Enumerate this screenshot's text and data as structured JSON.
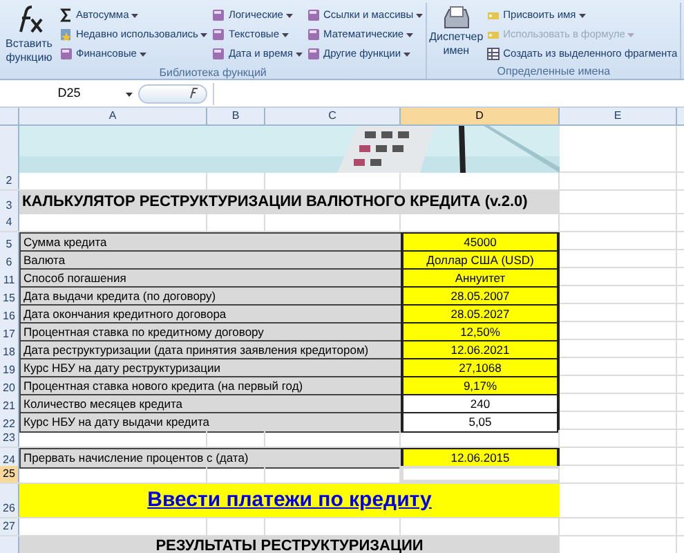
{
  "ribbon": {
    "insert_function": "Вставить функцию",
    "groups": [
      {
        "label": "Библиотека функций",
        "columns": [
          [
            {
              "text": "Автосумма",
              "dropdown": true,
              "disabled": false
            },
            {
              "text": "Недавно использовались",
              "dropdown": true,
              "disabled": false
            },
            {
              "text": "Финансовые",
              "dropdown": true,
              "disabled": false
            }
          ],
          [
            {
              "text": "Логические",
              "dropdown": true,
              "disabled": false
            },
            {
              "text": "Текстовые",
              "dropdown": true,
              "disabled": false
            },
            {
              "text": "Дата и время",
              "dropdown": true,
              "disabled": false
            }
          ],
          [
            {
              "text": "Ссылки и массивы",
              "dropdown": true,
              "disabled": false
            },
            {
              "text": "Математические",
              "dropdown": true,
              "disabled": false
            },
            {
              "text": "Другие функции",
              "dropdown": true,
              "disabled": false
            }
          ]
        ]
      },
      {
        "label": "Определенные имена",
        "big": "Диспетчер имен",
        "columns": [
          [
            {
              "text": "Присвоить имя",
              "dropdown": true,
              "disabled": false
            },
            {
              "text": "Использовать в формуле",
              "dropdown": true,
              "disabled": true
            },
            {
              "text": "Создать из выделенного фрагмента",
              "dropdown": false,
              "disabled": false
            }
          ]
        ]
      }
    ]
  },
  "name_box": "D25",
  "columns": [
    {
      "label": "A",
      "selected": false
    },
    {
      "label": "B",
      "selected": false
    },
    {
      "label": "C",
      "selected": false
    },
    {
      "label": "D",
      "selected": true
    },
    {
      "label": "E",
      "selected": false
    }
  ],
  "rows": [
    {
      "number": "",
      "kind": "banner",
      "selected": false
    },
    {
      "number": "2",
      "kind": "empty",
      "selected": false
    },
    {
      "number": "3",
      "kind": "title",
      "text": "КАЛЬКУЛЯТОР РЕСТРУКТУРИЗАЦИИ ВАЛЮТНОГО КРЕДИТА (v.2.0)",
      "selected": false
    },
    {
      "number": "4",
      "kind": "empty",
      "selected": false
    },
    {
      "number": "5",
      "kind": "field",
      "label": "Сумма кредита",
      "value": "45000",
      "input": true,
      "selected": false
    },
    {
      "number": "6",
      "kind": "field",
      "label": "Валюта",
      "value": "Доллар США (USD)",
      "input": true,
      "selected": false
    },
    {
      "number": "11",
      "kind": "field",
      "label": "Способ погашения",
      "value": "Аннуитет",
      "input": true,
      "selected": false
    },
    {
      "number": "15",
      "kind": "field",
      "label": "Дата выдачи кредита (по договору)",
      "value": "28.05.2007",
      "input": true,
      "selected": false
    },
    {
      "number": "16",
      "kind": "field",
      "label": "Дата окончания кредитного договора",
      "value": "28.05.2027",
      "input": true,
      "selected": false
    },
    {
      "number": "17",
      "kind": "field",
      "label": "Процентная ставка по кредитному договору",
      "value": "12,50%",
      "input": true,
      "selected": false
    },
    {
      "number": "18",
      "kind": "field",
      "label": "Дата реструктуризации (дата принятия заявления кредитором)",
      "value": "12.06.2021",
      "input": true,
      "selected": false
    },
    {
      "number": "19",
      "kind": "field",
      "label": "Курс НБУ на дату реструктуризации",
      "value": "27,1068",
      "input": true,
      "selected": false
    },
    {
      "number": "20",
      "kind": "field",
      "label": "Процентная ставка нового кредита (на первый год)",
      "value": "9,17%",
      "input": true,
      "selected": false
    },
    {
      "number": "21",
      "kind": "field",
      "label": "Количество месяцев кредита",
      "value": "240",
      "input": false,
      "selected": false
    },
    {
      "number": "22",
      "kind": "field",
      "label": "Курс НБУ на дату выдачи кредита",
      "value": "5,05",
      "input": false,
      "selected": false
    },
    {
      "number": "23",
      "kind": "empty",
      "selected": false
    },
    {
      "number": "24",
      "kind": "field",
      "label": "Прервать начисление процентов с (дата)",
      "value": "12.06.2015",
      "input": true,
      "selected": false
    },
    {
      "number": "25",
      "kind": "empty",
      "selected": true
    },
    {
      "number": "26",
      "kind": "link",
      "text": "Ввести платежи по кредиту",
      "selected": false
    },
    {
      "number": "27",
      "kind": "empty",
      "selected": false
    },
    {
      "number": "",
      "kind": "heading",
      "text": "РЕЗУЛЬТАТЫ РЕСТРУКТУРИЗАЦИИ",
      "selected": false
    }
  ]
}
